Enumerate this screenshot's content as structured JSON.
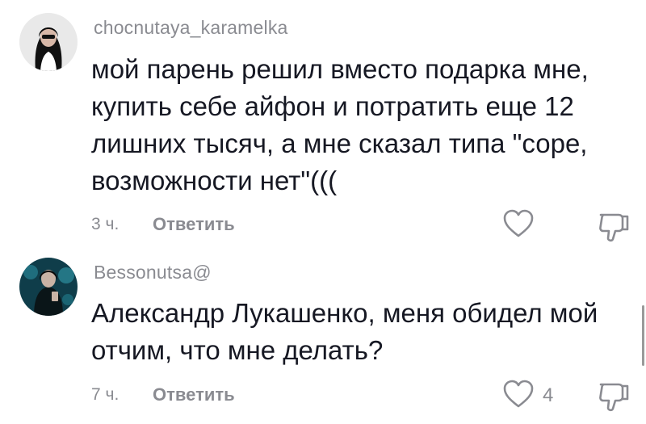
{
  "comments": [
    {
      "username": "chocnutaya_karamelka",
      "text": "мой парень решил вместо подарка мне, купить себе айфон и потратить еще 12 лишних тысяч, а мне сказал типа \"соре, возможности нет\"(((",
      "time": "3 ч.",
      "reply_label": "Ответить",
      "like_count": ""
    },
    {
      "username": "Bessonutsa@",
      "text": "Александр Лукашенко, меня обидел мой отчим, что мне делать?",
      "time": "7 ч.",
      "reply_label": "Ответить",
      "like_count": "4"
    }
  ],
  "icons": {
    "like": "heart-outline-icon",
    "dislike": "thumbs-down-outline-icon"
  },
  "colors": {
    "text": "#161823",
    "secondary": "#8a8b91",
    "background": "#ffffff"
  }
}
